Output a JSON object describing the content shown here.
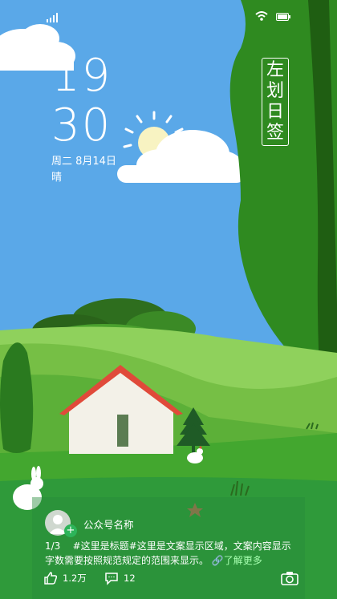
{
  "clock": {
    "hour": "19",
    "minute": "30"
  },
  "date_line": "周二 8月14日",
  "weather": "晴",
  "seal_text": [
    "左",
    "划",
    "日",
    "签"
  ],
  "author": "公众号名称",
  "post": {
    "index": "1/3",
    "text": "#这里是标题#这里是文案显示区域，文案内容显示字数需要按照规范规定的范围来显示。",
    "more": "了解更多"
  },
  "actions": {
    "likes": "1.2万",
    "comments": "12"
  },
  "colors": {
    "sky": "#5aa8e8",
    "tree_dark": "#2f7a1a",
    "grass": "#7dc24b",
    "roof": "#e84b3b"
  },
  "icons": [
    "signal-icon",
    "wifi-icon",
    "battery-icon",
    "sun-icon",
    "avatar-icon",
    "plus-icon",
    "like-icon",
    "comment-icon",
    "camera-icon",
    "link-icon"
  ]
}
